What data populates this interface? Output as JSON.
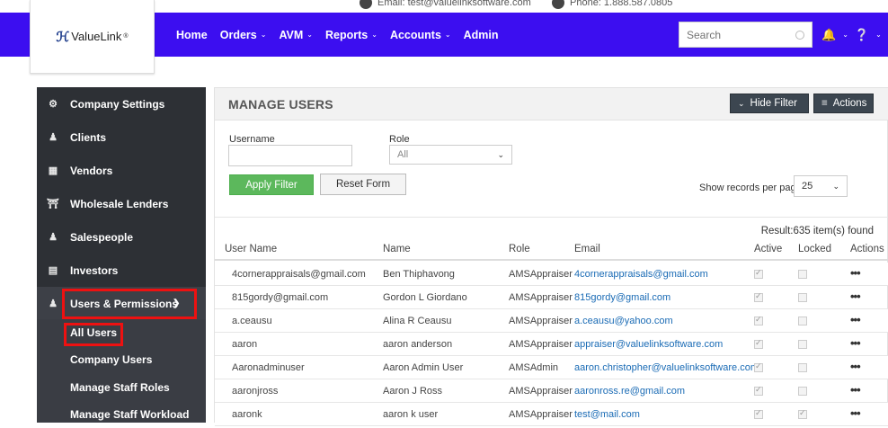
{
  "top": {
    "phone": "Phone: 1.888.587.0805",
    "email": "Email: test@valuelinksoftware.com"
  },
  "brand": {
    "name": "ValueLink",
    "mark": "®"
  },
  "nav": {
    "items": [
      {
        "label": "Home",
        "caret": false
      },
      {
        "label": "Orders",
        "caret": true
      },
      {
        "label": "AVM",
        "caret": true
      },
      {
        "label": "Reports",
        "caret": true
      },
      {
        "label": "Accounts",
        "caret": true
      },
      {
        "label": "Admin",
        "caret": false
      }
    ],
    "search_placeholder": "Search"
  },
  "sidebar": {
    "items": [
      {
        "label": "Company Settings",
        "icon": "gears-icon"
      },
      {
        "label": "Clients",
        "icon": "user-icon"
      },
      {
        "label": "Vendors",
        "icon": "building-icon"
      },
      {
        "label": "Wholesale Lenders",
        "icon": "bank-icon"
      },
      {
        "label": "Salespeople",
        "icon": "user-icon"
      },
      {
        "label": "Investors",
        "icon": "id-card-icon"
      },
      {
        "label": "Users & Permissions",
        "icon": "users-icon"
      }
    ],
    "subitems": [
      "All Users",
      "Company Users",
      "Manage Staff Roles",
      "Manage Staff Workload"
    ]
  },
  "main": {
    "title": "MANAGE USERS",
    "hide_filter": "Hide Filter",
    "actions": "Actions",
    "filter": {
      "username_label": "Username",
      "username_value": "",
      "role_label": "Role",
      "role_value": "All",
      "apply": "Apply Filter",
      "reset": "Reset Form",
      "records_label": "Show records per page",
      "records_value": "25"
    },
    "result": "Result:635 item(s) found",
    "columns": [
      "User Name",
      "Name",
      "Role",
      "Email",
      "Active",
      "Locked",
      "Actions"
    ],
    "rows": [
      {
        "user": "4cornerappraisals@gmail.com",
        "name": "Ben Thiphavong",
        "role": "AMSAppraiser",
        "email": "4cornerappraisals@gmail.com",
        "active": true,
        "locked": false
      },
      {
        "user": "815gordy@gmail.com",
        "name": "Gordon L Giordano",
        "role": "AMSAppraiser",
        "email": "815gordy@gmail.com",
        "active": true,
        "locked": false
      },
      {
        "user": "a.ceausu",
        "name": "Alina R Ceausu",
        "role": "AMSAppraiser",
        "email": "a.ceausu@yahoo.com",
        "active": true,
        "locked": false
      },
      {
        "user": "aaron",
        "name": "aaron anderson",
        "role": "AMSAppraiser",
        "email": "appraiser@valuelinksoftware.com",
        "active": true,
        "locked": false
      },
      {
        "user": "Aaronadminuser",
        "name": "Aaron Admin User",
        "role": "AMSAdmin",
        "email": "aaron.christopher@valuelinksoftware.com",
        "active": true,
        "locked": false
      },
      {
        "user": "aaronjross",
        "name": "Aaron J Ross",
        "role": "AMSAppraiser",
        "email": "aaronross.re@gmail.com",
        "active": true,
        "locked": false
      },
      {
        "user": "aaronk",
        "name": "aaron k user",
        "role": "AMSAppraiser",
        "email": "test@mail.com",
        "active": true,
        "locked": true
      }
    ]
  }
}
